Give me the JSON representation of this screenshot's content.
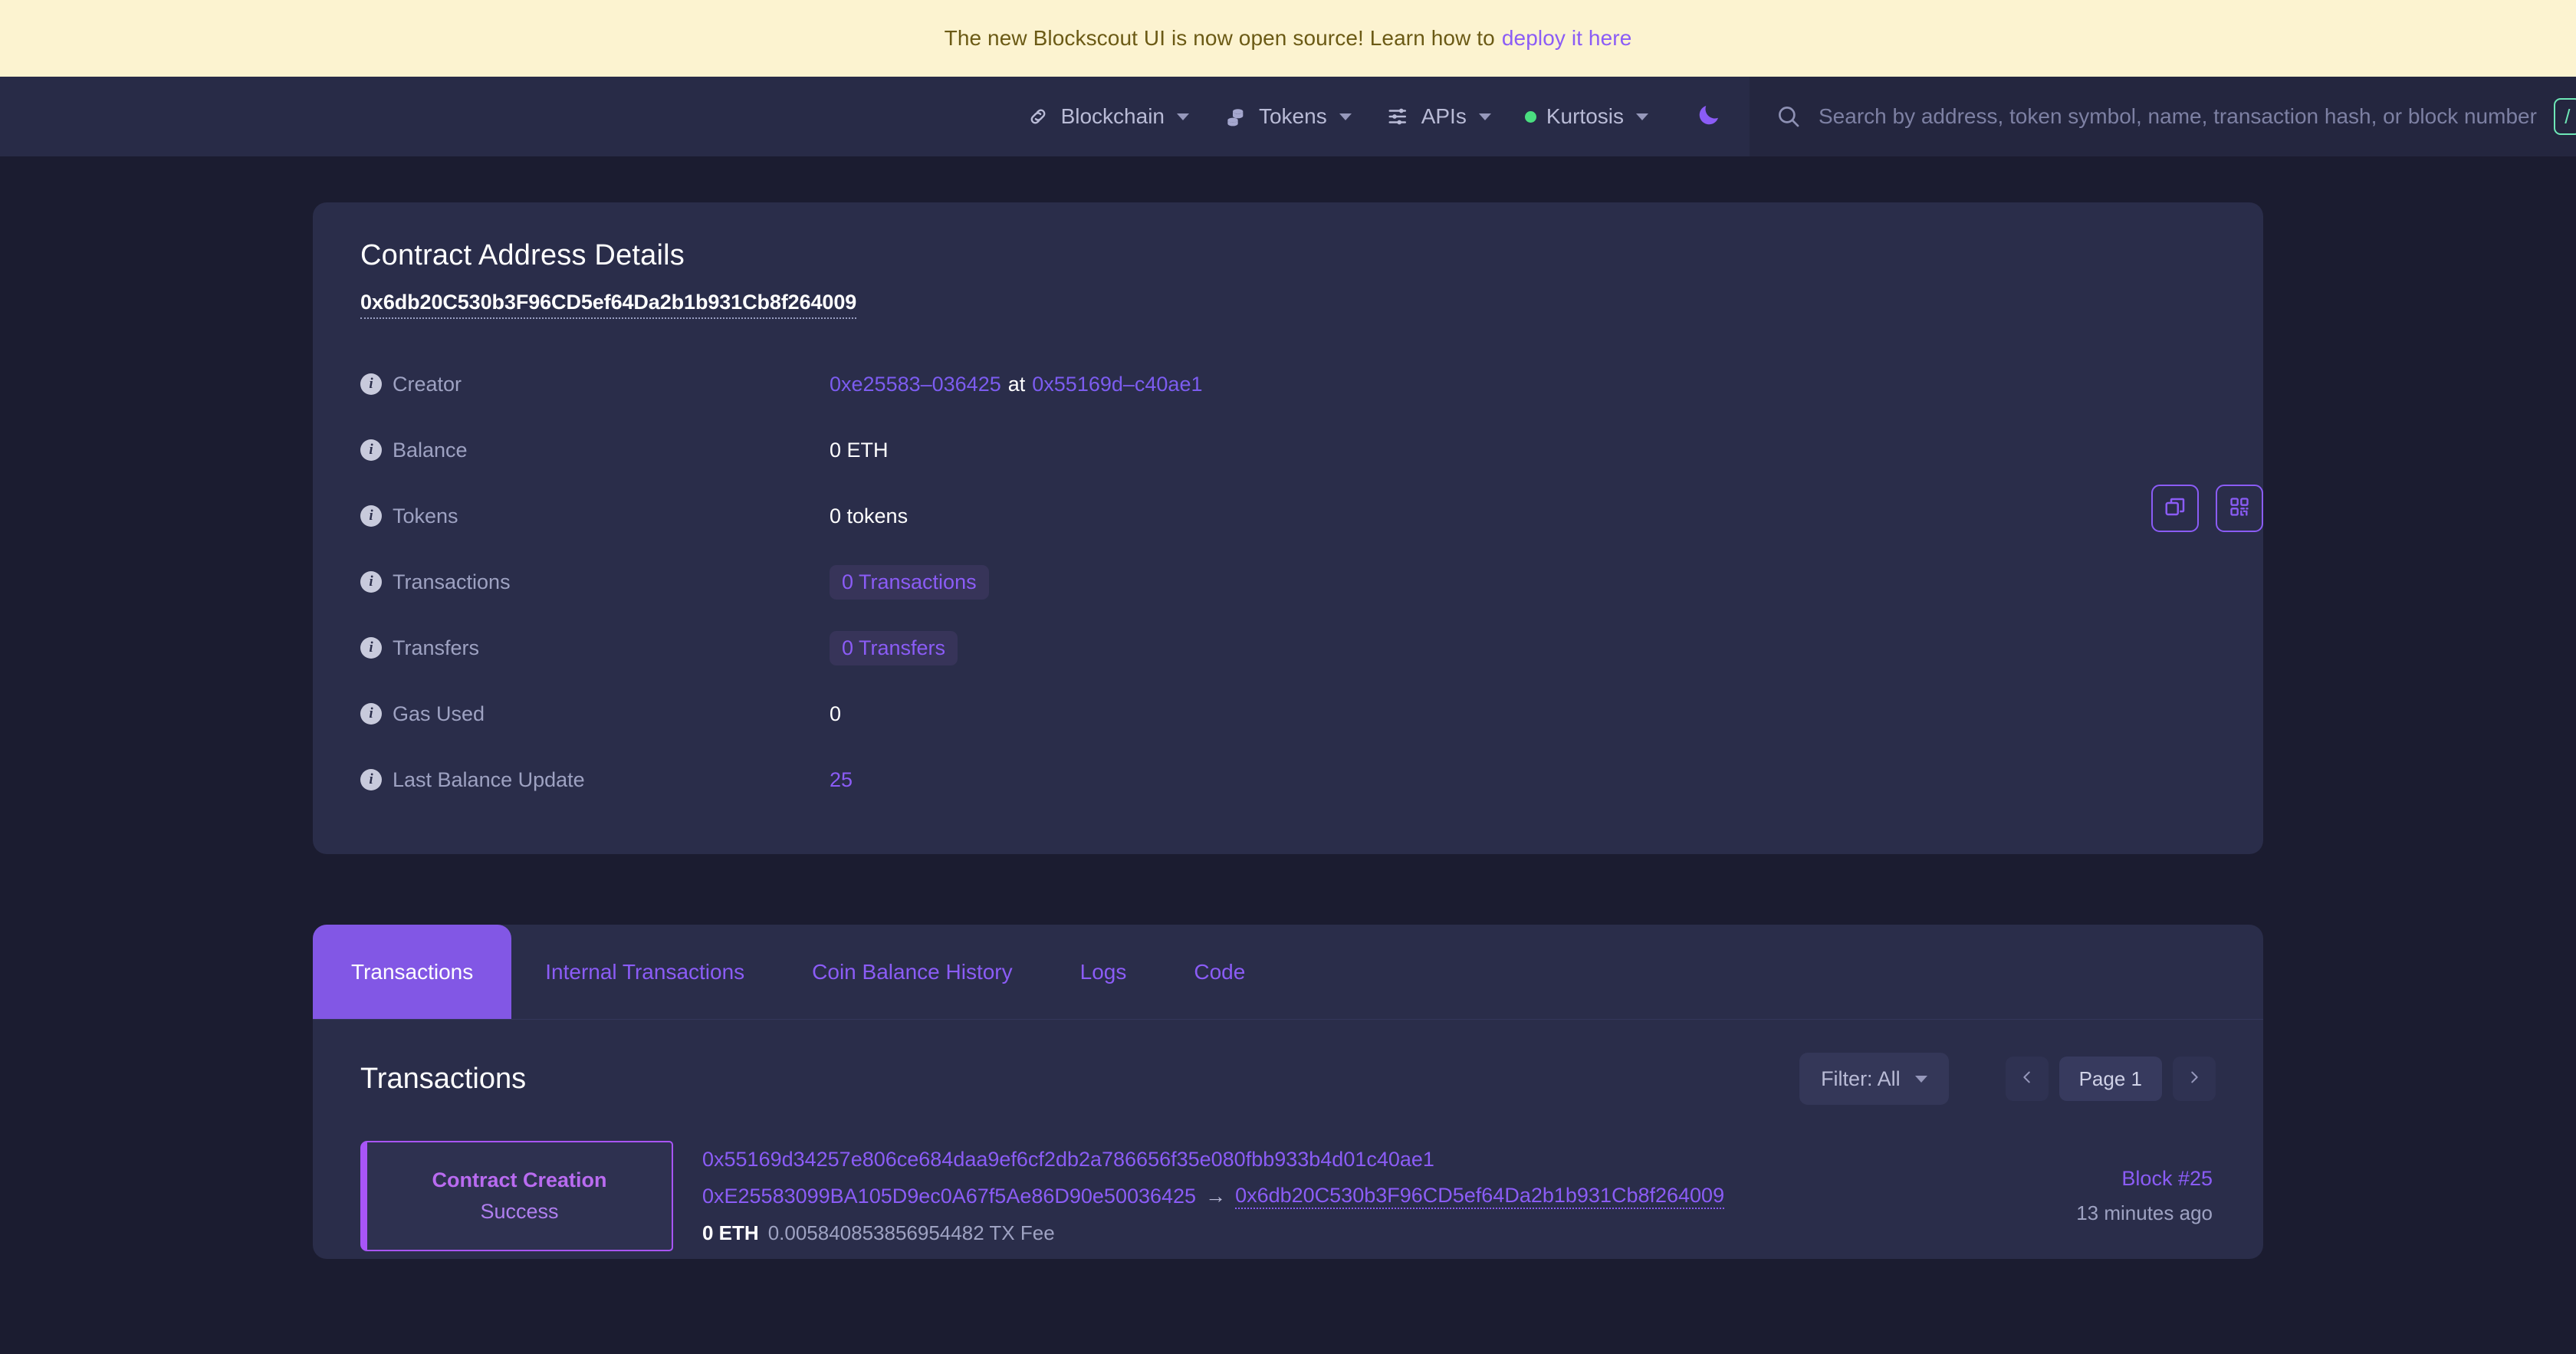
{
  "banner": {
    "text": "The new Blockscout UI is now open source! Learn how to",
    "link_label": "deploy it here"
  },
  "header": {
    "nav": [
      {
        "label": "Blockchain",
        "icon": "link-chain-icon",
        "has_caret": true
      },
      {
        "label": "Tokens",
        "icon": "coins-stack-icon",
        "has_caret": true
      },
      {
        "label": "APIs",
        "icon": "sliders-icon",
        "has_caret": true
      },
      {
        "label": "Kurtosis",
        "icon": "green-dot-icon",
        "has_caret": true
      }
    ],
    "theme_toggle_icon": "moon-icon",
    "search": {
      "icon": "search-icon",
      "placeholder": "Search by address, token symbol, name, transaction hash, or block number",
      "value": "",
      "shortcut_badge": "/"
    }
  },
  "address_card": {
    "title": "Contract Address Details",
    "hash": "0x6db20C530b3F96CD5ef64Da2b1b931Cb8f264009",
    "actions": [
      {
        "name": "copy-address-button",
        "icon": "copy-icon"
      },
      {
        "name": "qr-code-button",
        "icon": "qr-code-icon"
      }
    ],
    "details": [
      {
        "label": "Creator",
        "type": "creator",
        "creator_address": "0xe25583–036425",
        "at_word": "at",
        "creation_tx": "0x55169d–c40ae1"
      },
      {
        "label": "Balance",
        "type": "text",
        "value": "0 ETH"
      },
      {
        "label": "Tokens",
        "type": "text",
        "value": "0 tokens"
      },
      {
        "label": "Transactions",
        "type": "pill",
        "value": "0 Transactions"
      },
      {
        "label": "Transfers",
        "type": "pill",
        "value": "0 Transfers"
      },
      {
        "label": "Gas Used",
        "type": "text",
        "value": "0"
      },
      {
        "label": "Last Balance Update",
        "type": "link",
        "value": "25"
      }
    ]
  },
  "tabs": [
    {
      "label": "Transactions",
      "active": true
    },
    {
      "label": "Internal Transactions",
      "active": false
    },
    {
      "label": "Coin Balance History",
      "active": false
    },
    {
      "label": "Logs",
      "active": false
    },
    {
      "label": "Code",
      "active": false
    }
  ],
  "transactions_section": {
    "title": "Transactions",
    "filter_label": "Filter: All",
    "pager": {
      "prev_icon": "chevron-left-icon",
      "page_label": "Page 1",
      "next_icon": "chevron-right-icon"
    },
    "rows": [
      {
        "type": "Contract Creation",
        "status": "Success",
        "hash": "0x55169d34257e806ce684daa9ef6cf2db2a786656f35e080fbb933b4d01c40ae1",
        "from": "0xE25583099BA105D9ec0A67f5Ae86D90e50036425",
        "arrow": "→",
        "to": "0x6db20C530b3F96CD5ef64Da2b1b931Cb8f264009",
        "value": "0 ETH",
        "fee": "0.005840853856954482 TX Fee",
        "block": "Block #25",
        "age": "13 minutes ago"
      }
    ]
  },
  "colors": {
    "page_bg": "#1b1c30",
    "card_bg": "#2a2d4a",
    "accent_purple": "#8b5cf6",
    "active_tab": "#8257e5",
    "banner_bg": "#fcf3d0",
    "success_green": "#4ade80"
  }
}
